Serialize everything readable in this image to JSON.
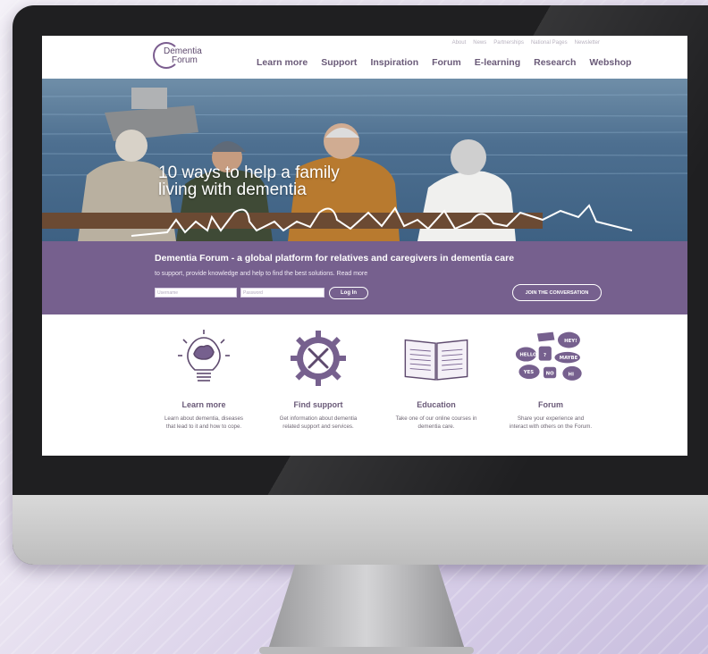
{
  "site": {
    "logo": {
      "line1": "Dementia",
      "line2": "Forum"
    },
    "top_links": [
      "About",
      "News",
      "Partnerships",
      "National Pages",
      "Newsletter"
    ],
    "nav": [
      "Learn more",
      "Support",
      "Inspiration",
      "Forum",
      "E-learning",
      "Research",
      "Webshop"
    ]
  },
  "hero": {
    "title_line1": "10 ways to help a family",
    "title_line2": "living with dementia"
  },
  "band": {
    "title": "Dementia Forum - a global platform for relatives and caregivers in dementia care",
    "subtitle": "to support, provide knowledge and help to find the best solutions. Read more",
    "username_placeholder": "Username",
    "password_placeholder": "Password",
    "login_label": "Log In",
    "join_label": "JOIN THE CONVERSATION"
  },
  "features": [
    {
      "icon": "lightbulb-brain-icon",
      "title": "Learn more",
      "desc_line1": "Learn about dementia, diseases",
      "desc_line2": "that lead to it and how to cope."
    },
    {
      "icon": "gear-tools-icon",
      "title": "Find support",
      "desc_line1": "Get information about dementia",
      "desc_line2": "related support and services."
    },
    {
      "icon": "open-book-icon",
      "title": "Education",
      "desc_line1": "Take one of our online courses in",
      "desc_line2": "dementia care."
    },
    {
      "icon": "speech-bubbles-icon",
      "title": "Forum",
      "desc_line1": "Share your experience and",
      "desc_line2": "interact with others on the Forum."
    }
  ],
  "bubbles": [
    "HEY!",
    "HELLO",
    "?",
    "YES",
    "MAYBE",
    "NO",
    "HI"
  ],
  "colors": {
    "brand_purple": "#76608e",
    "nav_text": "#6a5a78",
    "bezel": "#1f1f21"
  }
}
